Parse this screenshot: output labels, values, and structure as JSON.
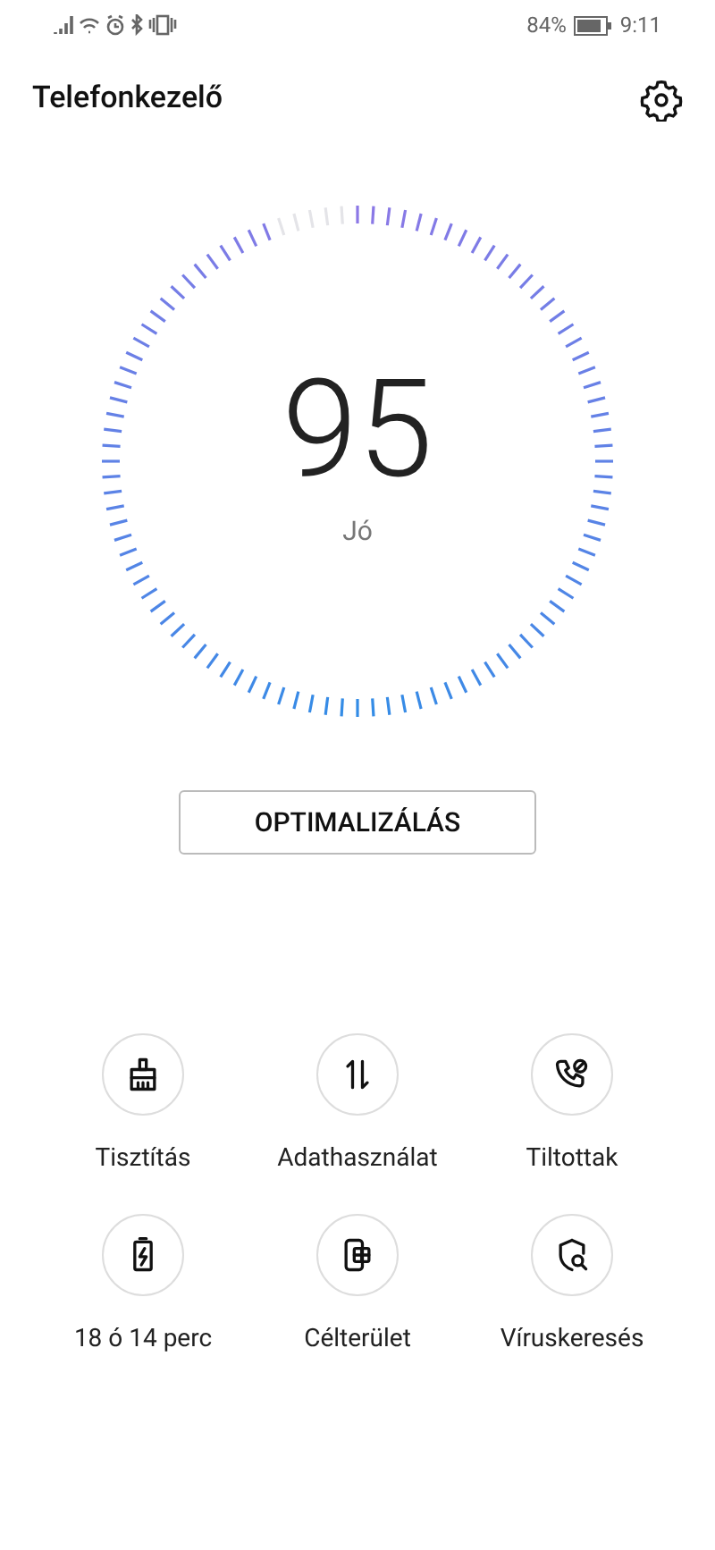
{
  "status_bar": {
    "battery": "84%",
    "time": "9:11"
  },
  "header": {
    "title": "Telefonkezelő"
  },
  "score": {
    "value": "95",
    "label": "Jó"
  },
  "optimize_button": {
    "label": "OPTIMALIZÁLÁS"
  },
  "tools": [
    {
      "kind": "broom",
      "label": "Tisztítás"
    },
    {
      "kind": "data",
      "label": "Adathasználat"
    },
    {
      "kind": "blocked",
      "label": "Tiltottak"
    },
    {
      "kind": "battery",
      "label": "18 ó 14 perc"
    },
    {
      "kind": "apps",
      "label": "Célterület"
    },
    {
      "kind": "virus",
      "label": "Víruskeresés"
    }
  ]
}
